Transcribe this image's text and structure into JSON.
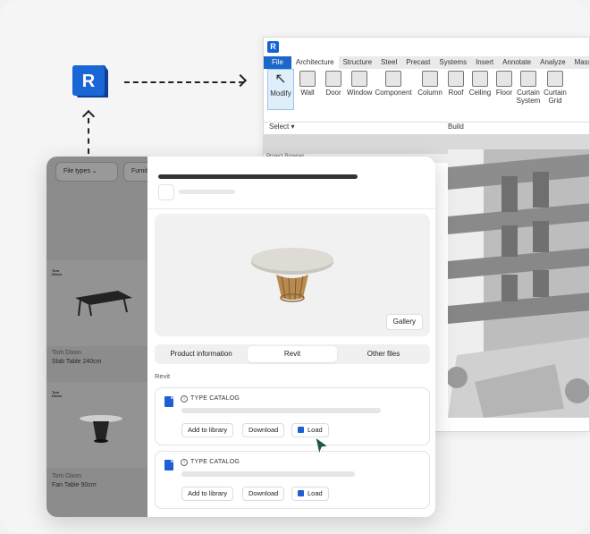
{
  "revit_logo": {
    "letter": "R"
  },
  "revit_window": {
    "badge": "R",
    "tabs": [
      "File",
      "Architecture",
      "Structure",
      "Steel",
      "Precast",
      "Systems",
      "Insert",
      "Annotate",
      "Analyze",
      "Mass"
    ],
    "active_tab": "Architecture",
    "ribbon_buttons": [
      "Modify",
      "Wall",
      "Door",
      "Window",
      "Component",
      "Column",
      "Roof",
      "Ceiling",
      "Floor",
      "Curtain System",
      "Curtain Grid"
    ],
    "select_label": "Select",
    "build_label": "Build",
    "project_browser_label": "Project Browser"
  },
  "catalog": {
    "filters": [
      "File types",
      "Furniture"
    ],
    "items": [
      {
        "brand": "Tom Dixon",
        "name": "Slab Table 240cm"
      },
      {
        "brand": "Tom Dixon",
        "name": "Fan Table 90cm"
      }
    ],
    "brand_mark": "Tom Dixon"
  },
  "detail": {
    "gallery_label": "Gallery",
    "tabs": [
      "Product information",
      "Revit",
      "Other files"
    ],
    "active_tab": "Revit",
    "section_label": "Revit",
    "files": [
      {
        "type_label": "TYPE CATALOG",
        "buttons": [
          "Add to library",
          "Download",
          "Load"
        ]
      },
      {
        "type_label": "TYPE CATALOG",
        "buttons": [
          "Add to library",
          "Download",
          "Load"
        ]
      }
    ]
  },
  "colors": {
    "revit_blue": "#1f5fd6",
    "cursor_green": "#1e5a3a"
  }
}
